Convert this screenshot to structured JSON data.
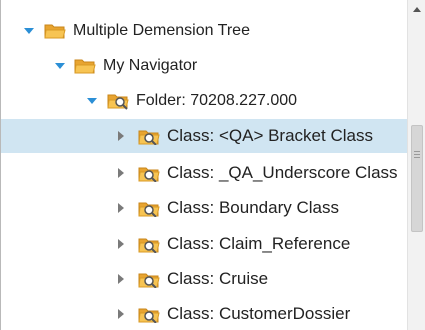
{
  "colors": {
    "selection": "#d0e5f2",
    "expanded_arrow": "#2b8fd6",
    "collapsed_arrow": "#7a7a7a",
    "folder": "#f4b63f"
  },
  "tree": {
    "root": {
      "label": "Multiple Demension Tree",
      "icon": "folder-icon"
    },
    "navigator": {
      "label": "My Navigator",
      "icon": "folder-icon"
    },
    "folder": {
      "label": "Folder: 70208.227.000",
      "icon": "folder-search-icon"
    },
    "classes": [
      {
        "label": "Class: <QA> Bracket Class",
        "icon": "class-search-icon",
        "selected": true
      },
      {
        "label": "Class: _QA_Underscore Class",
        "icon": "class-search-icon"
      },
      {
        "label": "Class: Boundary Class",
        "icon": "class-search-icon"
      },
      {
        "label": "Class: Claim_Reference",
        "icon": "class-search-icon"
      },
      {
        "label": "Class: Cruise",
        "icon": "class-search-icon"
      },
      {
        "label": "Class: CustomerDossier",
        "icon": "class-search-icon"
      }
    ]
  }
}
